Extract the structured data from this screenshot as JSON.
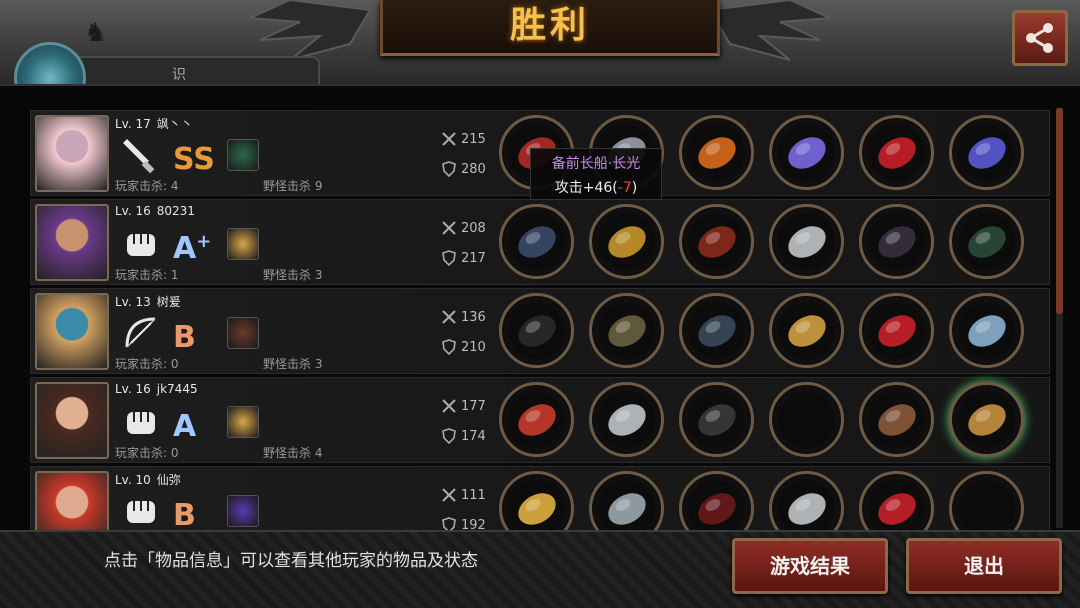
{
  "header": {
    "title": "胜利"
  },
  "tab": {
    "label": "识"
  },
  "tooltip": {
    "item_name": "备前长船·长光",
    "stat": "攻击+46(",
    "delta": "-7",
    "stat_end": ")"
  },
  "players": [
    {
      "level": "Lv. 17",
      "name": "飒丶丶",
      "rank": "SS",
      "rank_sup": "",
      "rank_color": "#e89a3a",
      "weapon_icon": "knife-icon",
      "player_kills": "玩家击杀: 4",
      "monster_kills": "野怪击杀 9",
      "attack": "215",
      "defense": "280",
      "portrait_colors": [
        "#f2c9cf",
        "#c9a5b8"
      ],
      "pet_color": "#2b6a4a"
    },
    {
      "level": "Lv. 16",
      "name": "80231",
      "rank": "A",
      "rank_sup": "+",
      "rank_color": "#9fc8ff",
      "weapon_icon": "fist-icon",
      "player_kills": "玩家击杀: 1",
      "monster_kills": "野怪击杀 3",
      "attack": "208",
      "defense": "217",
      "portrait_colors": [
        "#6a3a8a",
        "#c8926e"
      ],
      "pet_color": "#d8a64a"
    },
    {
      "level": "Lv. 13",
      "name": "树爰",
      "rank": "B",
      "rank_sup": "",
      "rank_color": "#e89a6a",
      "weapon_icon": "bow-icon",
      "player_kills": "玩家击杀: 0",
      "monster_kills": "野怪击杀 3",
      "attack": "136",
      "defense": "210",
      "portrait_colors": [
        "#d2a060",
        "#3a8aa8"
      ],
      "pet_color": "#6a3a2a"
    },
    {
      "level": "Lv. 16",
      "name": "jk7445",
      "rank": "A",
      "rank_sup": "",
      "rank_color": "#9fc8ff",
      "weapon_icon": "fist-icon",
      "player_kills": "玩家击杀: 0",
      "monster_kills": "野怪击杀 4",
      "attack": "177",
      "defense": "174",
      "portrait_colors": [
        "#4a2a20",
        "#e0b090"
      ],
      "pet_color": "#d8a64a"
    },
    {
      "level": "Lv. 10",
      "name": "仙弥",
      "rank": "B",
      "rank_sup": "",
      "rank_color": "#e89a6a",
      "weapon_icon": "fist-icon",
      "player_kills": "",
      "monster_kills": "",
      "attack": "111",
      "defense": "192",
      "portrait_colors": [
        "#c83a2a",
        "#e0a890"
      ],
      "pet_color": "#5a3ab0"
    }
  ],
  "items": [
    [
      "#b52a2a",
      "#9aa0a8",
      "#d86a1a",
      "#7a6ae0",
      "#c8202a",
      "#5a5ad8"
    ],
    [
      "#3a4a6a",
      "#c8962a",
      "#8a2a1a",
      "#c0c4c8",
      "#3a3040",
      "#2a4a3a"
    ],
    [
      "#2a2a2a",
      "#6a6040",
      "#3a4a5a",
      "#d0a040",
      "#c8202a",
      "#8ab0d0"
    ],
    [
      "#c83a2a",
      "#c0c4c8",
      "#3a3a3a",
      "",
      "#8a5a3a",
      "#c89040"
    ],
    [
      "#e0b040",
      "#9aa8b0",
      "#6a1a1a",
      "#c0c4c8",
      "#c8202a",
      ""
    ]
  ],
  "footer": {
    "hint": "点击「物品信息」可以查看其他玩家的物品及状态",
    "result_button": "游戏结果",
    "exit_button": "退出"
  }
}
